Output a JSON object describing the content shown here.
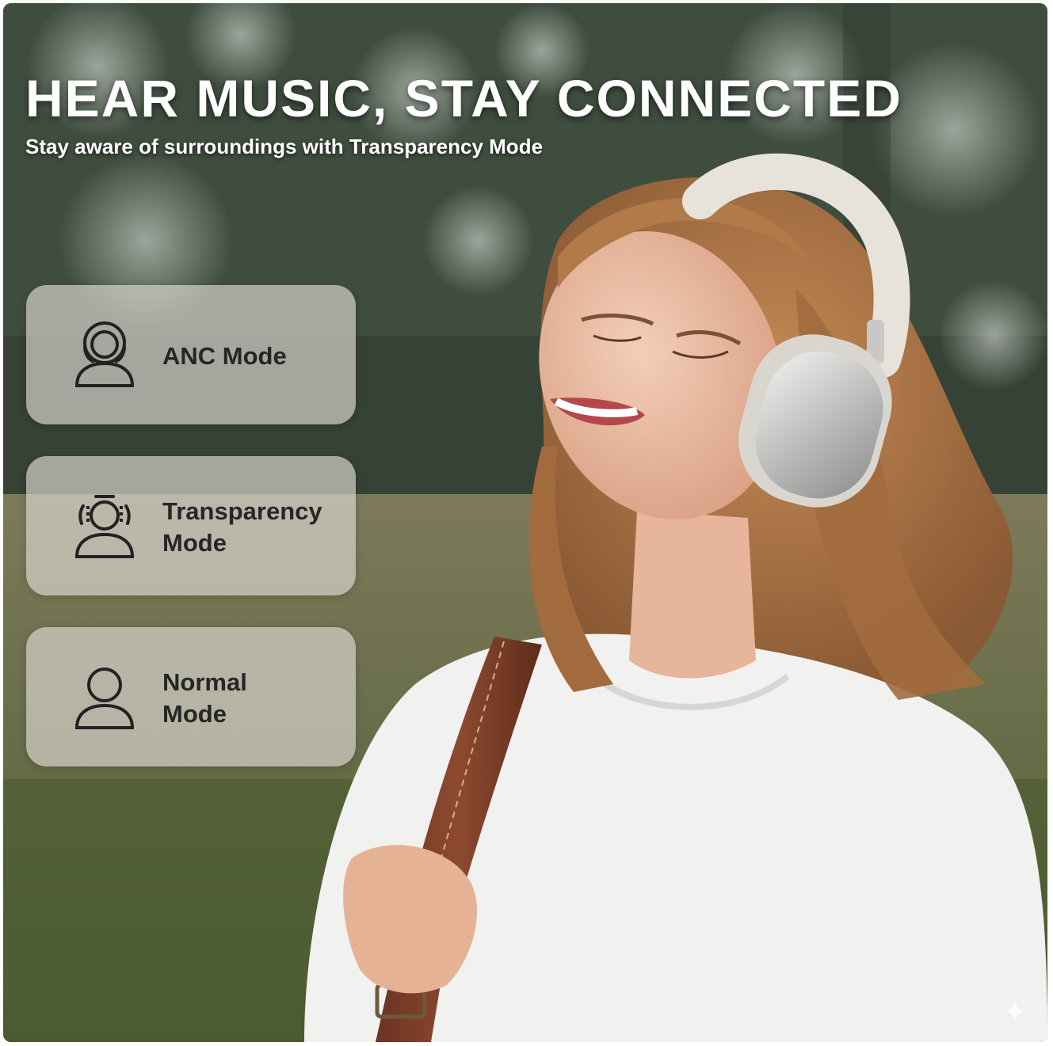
{
  "headline": "HEAR MUSIC, STAY CONNECTED",
  "subheadline": "Stay aware of surroundings with Transparency Mode",
  "modes": [
    {
      "icon": "anc-mode-icon",
      "line1": "ANC Mode",
      "line2": ""
    },
    {
      "icon": "transparency-mode-icon",
      "line1": "Transparency",
      "line2": "Mode"
    },
    {
      "icon": "normal-mode-icon",
      "line1": "Normal",
      "line2": "Mode"
    }
  ],
  "colors": {
    "headline_text": "#ffffff",
    "card_background": "#dad6d0",
    "card_text": "#262626"
  }
}
